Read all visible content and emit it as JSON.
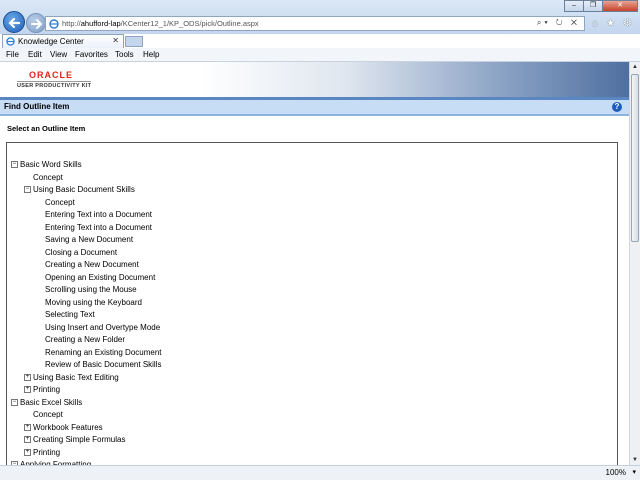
{
  "browser": {
    "url_prefix": "http://",
    "url_host": "ahufford-lap",
    "url_path": "/KCenter12_1/KP_ODS/pick/Outline.aspx",
    "address_tools": "⌕▾ ↻ ✕",
    "tab_title": "Knowledge Center",
    "tab_close": "✕",
    "win_minimize": "–",
    "win_restore": "❐",
    "win_close": "✕",
    "home": "⌂",
    "favorites": "★",
    "tools": "⚙"
  },
  "menu": [
    "File",
    "Edit",
    "View",
    "Favorites",
    "Tools",
    "Help"
  ],
  "page": {
    "oracle": "ORACLE",
    "product": "USER PRODUCTIVITY KIT",
    "find_title": "Find Outline Item",
    "help": "?",
    "select_label": "Select an Outline Item"
  },
  "tree": [
    {
      "level": 0,
      "expander": "minus",
      "label": "Basic Word Skills"
    },
    {
      "level": 1,
      "expander": "none",
      "label": "Concept"
    },
    {
      "level": 1,
      "expander": "minus",
      "label": "Using Basic Document Skills"
    },
    {
      "level": 2,
      "expander": "none",
      "label": "Concept"
    },
    {
      "level": 2,
      "expander": "none",
      "label": "Entering Text into a Document"
    },
    {
      "level": 2,
      "expander": "none",
      "label": "Entering Text into a Document"
    },
    {
      "level": 2,
      "expander": "none",
      "label": "Saving a New Document"
    },
    {
      "level": 2,
      "expander": "none",
      "label": "Closing a Document"
    },
    {
      "level": 2,
      "expander": "none",
      "label": "Creating a New Document"
    },
    {
      "level": 2,
      "expander": "none",
      "label": "Opening an Existing Document"
    },
    {
      "level": 2,
      "expander": "none",
      "label": "Scrolling using the Mouse"
    },
    {
      "level": 2,
      "expander": "none",
      "label": "Moving using the Keyboard"
    },
    {
      "level": 2,
      "expander": "none",
      "label": "Selecting Text"
    },
    {
      "level": 2,
      "expander": "none",
      "label": "Using Insert and Overtype Mode"
    },
    {
      "level": 2,
      "expander": "none",
      "label": "Creating a New Folder"
    },
    {
      "level": 2,
      "expander": "none",
      "label": "Renaming an Existing Document"
    },
    {
      "level": 2,
      "expander": "none",
      "label": "Review of Basic Document Skills"
    },
    {
      "level": 1,
      "expander": "plus",
      "label": "Using Basic Text Editing"
    },
    {
      "level": 1,
      "expander": "plus",
      "label": "Printing"
    },
    {
      "level": 0,
      "expander": "minus",
      "label": "Basic Excel Skills"
    },
    {
      "level": 1,
      "expander": "none",
      "label": "Concept"
    },
    {
      "level": 1,
      "expander": "plus",
      "label": "Workbook Features"
    },
    {
      "level": 1,
      "expander": "plus",
      "label": "Creating Simple Formulas"
    },
    {
      "level": 1,
      "expander": "plus",
      "label": "Printing"
    },
    {
      "level": 0,
      "expander": "minus",
      "label": "Applying Formatting"
    }
  ],
  "status": {
    "zoom": "100%",
    "zoom_drop": "▾"
  },
  "scroll": {
    "up": "▲",
    "down": "▼"
  }
}
